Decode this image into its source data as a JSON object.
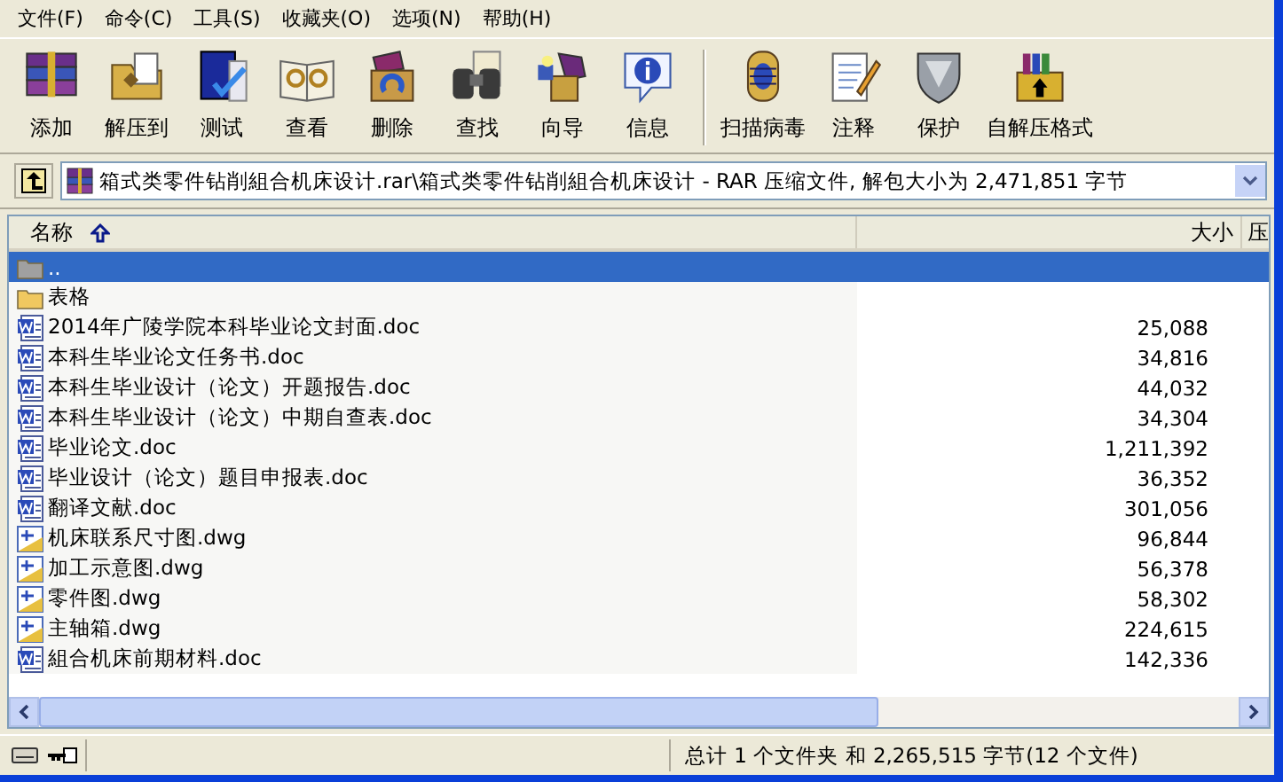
{
  "menu": [
    "文件(F)",
    "命令(C)",
    "工具(S)",
    "收藏夹(O)",
    "选项(N)",
    "帮助(H)"
  ],
  "toolbar": {
    "groups": [
      {
        "buttons": [
          "添加",
          "解压到",
          "测试",
          "查看",
          "删除",
          "查找",
          "向导",
          "信息"
        ]
      },
      {
        "buttons": [
          "扫描病毒",
          "注释",
          "保护",
          "自解压格式"
        ]
      }
    ]
  },
  "address": {
    "path": "箱式类零件钻削組合机床设计.rar\\箱式类零件钻削組合机床设计 - RAR 压缩文件, 解包大小为 2,471,851 字节"
  },
  "columns": [
    {
      "label": "名称",
      "sorted": true
    },
    {
      "label": "大小",
      "sorted": false
    },
    {
      "label": "压",
      "sorted": false
    }
  ],
  "rows": [
    {
      "kind": "parent",
      "name": "..",
      "selected": true
    },
    {
      "kind": "folder",
      "name": "表格",
      "selected": false
    },
    {
      "kind": "doc",
      "name": "2014年广陵学院本科毕业论文封面.doc",
      "size": "25,088",
      "selected": false
    },
    {
      "kind": "doc",
      "name": "本科生毕业论文任务书.doc",
      "size": "34,816",
      "selected": false
    },
    {
      "kind": "doc",
      "name": "本科生毕业设计（论文）开题报告.doc",
      "size": "44,032",
      "selected": false
    },
    {
      "kind": "doc",
      "name": "本科生毕业设计（论文）中期自查表.doc",
      "size": "34,304",
      "selected": false
    },
    {
      "kind": "doc",
      "name": "毕业论文.doc",
      "size": "1,211,392",
      "selected": false
    },
    {
      "kind": "doc",
      "name": "毕业设计（论文）题目申报表.doc",
      "size": "36,352",
      "selected": false
    },
    {
      "kind": "doc",
      "name": "翻译文献.doc",
      "size": "301,056",
      "selected": false
    },
    {
      "kind": "dwg",
      "name": "机床联系尺寸图.dwg",
      "size": "96,844",
      "selected": false
    },
    {
      "kind": "dwg",
      "name": "加工示意图.dwg",
      "size": "56,378",
      "selected": false
    },
    {
      "kind": "dwg",
      "name": "零件图.dwg",
      "size": "58,302",
      "selected": false
    },
    {
      "kind": "dwg",
      "name": "主轴箱.dwg",
      "size": "224,615",
      "selected": false
    },
    {
      "kind": "doc",
      "name": "組合机床前期材料.doc",
      "size": "142,336",
      "selected": false
    }
  ],
  "status_bar": {
    "text": "总计 1 个文件夹 和 2,265,515 字节(12 个文件)"
  }
}
